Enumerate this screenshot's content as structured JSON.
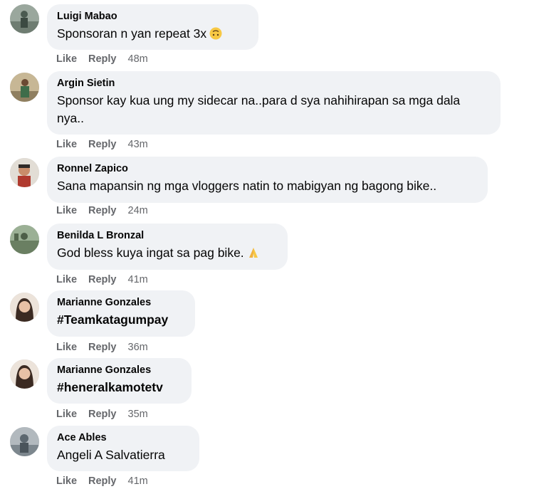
{
  "comments": [
    {
      "author": "Luigi Mabao",
      "text": "Sponsoran n yan repeat 3x",
      "emoji": "upside-down-face-emoji",
      "like_label": "Like",
      "reply_label": "Reply",
      "time": "48m",
      "avatar_colors": [
        "#8a9a8e",
        "#4a5a50"
      ]
    },
    {
      "author": "Argin Sietin",
      "text": "Sponsor kay kua ung my sidecar na..para d sya nahihirapan sa mga dala nya..",
      "like_label": "Like",
      "reply_label": "Reply",
      "time": "43m",
      "avatar_colors": [
        "#b9a887",
        "#3f6d4a"
      ]
    },
    {
      "author": "Ronnel Zapico",
      "text": "Sana mapansin ng mga vloggers natin to mabigyan ng bagong bike..",
      "like_label": "Like",
      "reply_label": "Reply",
      "time": "24m",
      "avatar_colors": [
        "#d8d2c8",
        "#b03a2e"
      ]
    },
    {
      "author": "Benilda L Bronzal",
      "text": "God bless kuya ingat sa pag bike.",
      "emoji": "folded-hands-emoji",
      "like_label": "Like",
      "reply_label": "Reply",
      "time": "41m",
      "avatar_colors": [
        "#8fa489",
        "#55664f"
      ]
    },
    {
      "author": "Marianne Gonzales",
      "text": "#Teamkatagumpay",
      "like_label": "Like",
      "reply_label": "Reply",
      "time": "36m",
      "avatar_colors": [
        "#e9ddd2",
        "#3b2a22"
      ]
    },
    {
      "author": "Marianne Gonzales",
      "text": "#heneralkamotetv",
      "like_label": "Like",
      "reply_label": "Reply",
      "time": "35m",
      "avatar_colors": [
        "#e9ddd2",
        "#3b2a22"
      ]
    },
    {
      "author": "Ace Ables",
      "text": "Angeli A Salvatierra",
      "like_label": "Like",
      "reply_label": "Reply",
      "time": "41m",
      "avatar_colors": [
        "#a7aeb4",
        "#5d6870"
      ]
    }
  ]
}
